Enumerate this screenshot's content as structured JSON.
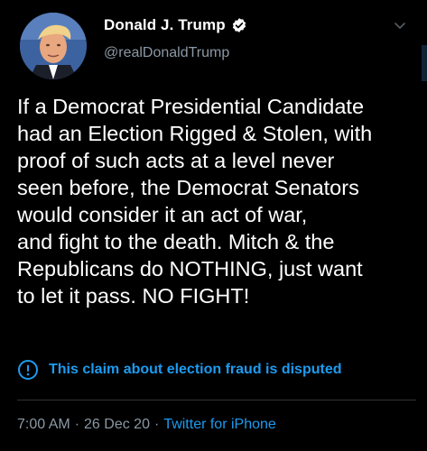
{
  "tweet": {
    "author": {
      "display_name": "Donald J. Trump",
      "handle": "@realDonaldTrump",
      "verified": true
    },
    "text": "If a Democrat Presidential Candidate\nhad an Election Rigged & Stolen, with\nproof of such acts at a level never\nseen before, the Democrat Senators\nwould consider it an act of war,\nand fight to the death. Mitch & the\nRepublicans do NOTHING, just want\nto let it pass. NO FIGHT!",
    "notice": {
      "icon": "exclamation-circle-icon",
      "text": "This claim about election fraud is disputed"
    },
    "meta": {
      "time": "7:00 AM",
      "date": "26 Dec 20",
      "separator": "·",
      "source": "Twitter for iPhone"
    }
  },
  "colors": {
    "background": "#000000",
    "text": "#ffffff",
    "secondary": "#8b98a5",
    "accent": "#1d9bf0",
    "divider": "#2f3336"
  }
}
